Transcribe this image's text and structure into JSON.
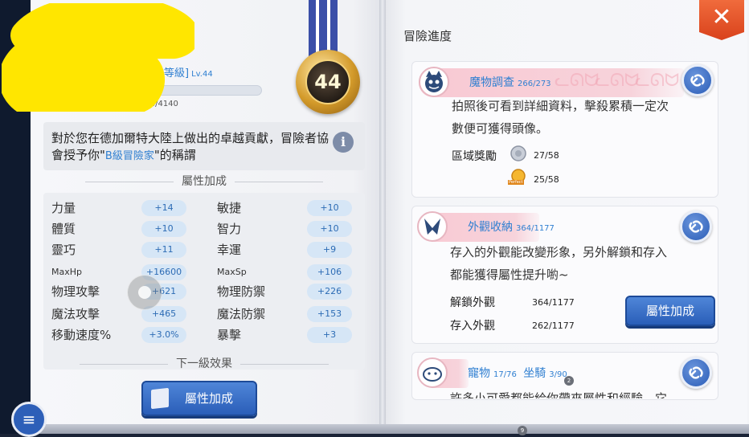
{
  "left": {
    "level": {
      "label": "冒險等級]",
      "lv": "Lv.44",
      "exp_text": "248/4140",
      "exp_progress": 0.06
    },
    "medal_number": "44",
    "description": {
      "pre": "對於您在德加爾特大陸上做出的卓越貢獻，冒險者協會授予你\"",
      "highlight": "B級冒險家",
      "post": "\"的稱謂"
    },
    "section_bonus": "屬性加成",
    "stats": [
      {
        "label": "力量",
        "value": "+14"
      },
      {
        "label": "敏捷",
        "value": "+10"
      },
      {
        "label": "體質",
        "value": "+10"
      },
      {
        "label": "智力",
        "value": "+10"
      },
      {
        "label": "靈巧",
        "value": "+11"
      },
      {
        "label": "幸運",
        "value": "+9"
      },
      {
        "label": "MaxHp",
        "value": "+16600"
      },
      {
        "label": "MaxSp",
        "value": "+106"
      },
      {
        "label": "物理攻擊",
        "value": "+621"
      },
      {
        "label": "物理防禦",
        "value": "+226"
      },
      {
        "label": "魔法攻擊",
        "value": "+465"
      },
      {
        "label": "魔法防禦",
        "value": "+153"
      },
      {
        "label": "移動速度%",
        "value": "+3.0%"
      },
      {
        "label": "暴擊",
        "value": "+3"
      }
    ],
    "section_next": "下一級效果",
    "button_label": "屬性加成"
  },
  "right": {
    "title": "冒險進度",
    "close_label": "✕",
    "monster": {
      "title": "魔物調查",
      "count": "266/273",
      "desc_line1": "拍照後可看到詳細資料，擊殺累積一定次",
      "desc_line2": "數便可獲得頭像。",
      "zone_label": "區域獎勵",
      "zone_val1": "27/58",
      "zone_val2": "25/58",
      "zone_icon2_text": "Perfect"
    },
    "appearance": {
      "title": "外觀收納",
      "count": "364/1177",
      "desc_line1": "存入的外觀能改變形象，另外解鎖和存入",
      "desc_line2": "都能獲得屬性提升喲~",
      "unlock_label": "解鎖外觀",
      "unlock_val": "364/1177",
      "store_label": "存入外觀",
      "store_val": "262/1177",
      "button_label": "屬性加成"
    },
    "pets": {
      "title_pet": "寵物",
      "pet_count": "17/76",
      "title_mount": "坐騎",
      "mount_count": "3/90",
      "badge": "2",
      "desc_partial": "許多小可愛都能給你帶來屬性和經驗，它"
    },
    "page_badge": "9"
  },
  "colors": {
    "accent": "#2f7fd1",
    "button": "#2a5eb8",
    "close": "#d9421c",
    "header_pink": "#f8c9d3"
  }
}
